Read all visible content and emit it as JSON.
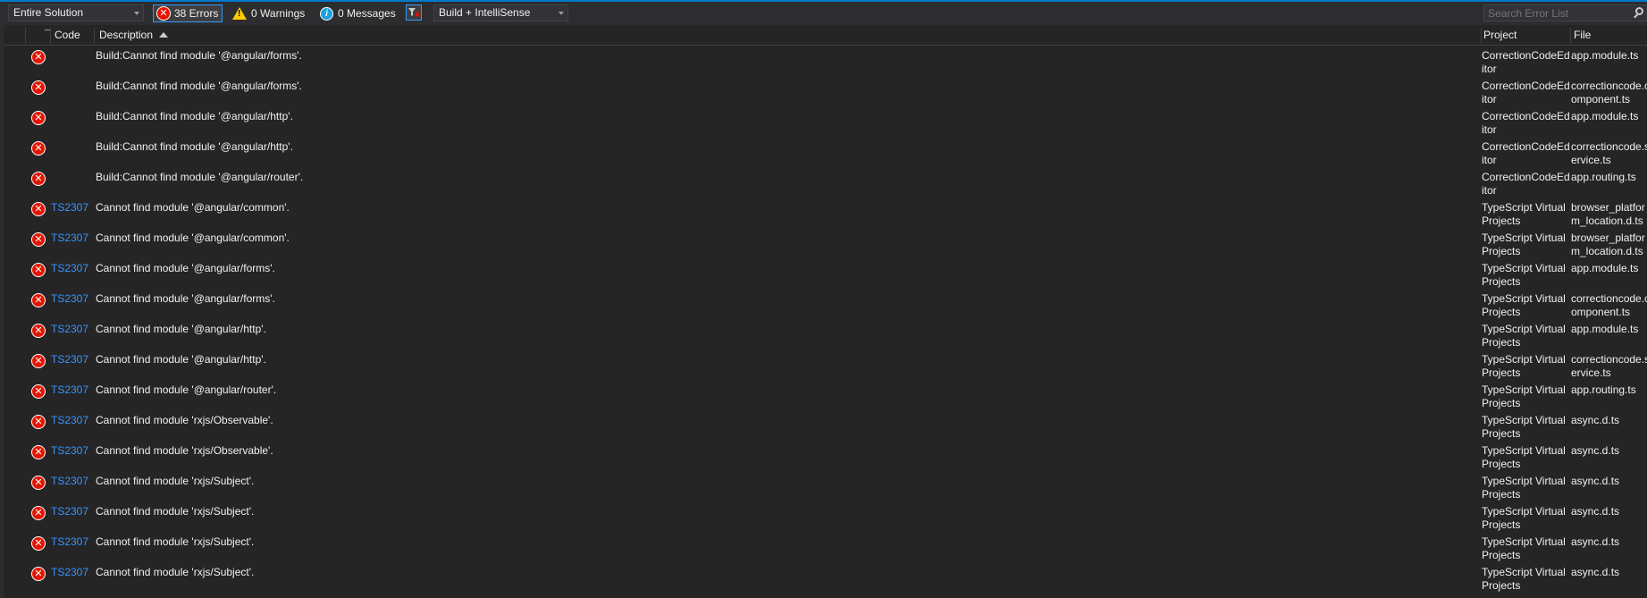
{
  "toolbar": {
    "scope_value": "Entire Solution",
    "errors_label": "38 Errors",
    "warnings_label": "0 Warnings",
    "messages_label": "0 Messages",
    "source_value": "Build + IntelliSense",
    "search_placeholder": "Search Error List"
  },
  "columns": {
    "code": "Code",
    "description": "Description",
    "project": "Project",
    "file": "File"
  },
  "rows": [
    {
      "code": "",
      "description": "Build:Cannot find module '@angular/forms'.",
      "project": "CorrectionCodeEditor",
      "file": "app.module.ts"
    },
    {
      "code": "",
      "description": "Build:Cannot find module '@angular/forms'.",
      "project": "CorrectionCodeEditor",
      "file": "correctioncode.component.ts"
    },
    {
      "code": "",
      "description": "Build:Cannot find module '@angular/http'.",
      "project": "CorrectionCodeEditor",
      "file": "app.module.ts"
    },
    {
      "code": "",
      "description": "Build:Cannot find module '@angular/http'.",
      "project": "CorrectionCodeEditor",
      "file": "correctioncode.service.ts"
    },
    {
      "code": "",
      "description": "Build:Cannot find module '@angular/router'.",
      "project": "CorrectionCodeEditor",
      "file": "app.routing.ts"
    },
    {
      "code": "TS2307",
      "description": "Cannot find module '@angular/common'.",
      "project": "TypeScript Virtual Projects",
      "file": "browser_platform_location.d.ts"
    },
    {
      "code": "TS2307",
      "description": "Cannot find module '@angular/common'.",
      "project": "TypeScript Virtual Projects",
      "file": "browser_platform_location.d.ts"
    },
    {
      "code": "TS2307",
      "description": "Cannot find module '@angular/forms'.",
      "project": "TypeScript Virtual Projects",
      "file": "app.module.ts"
    },
    {
      "code": "TS2307",
      "description": "Cannot find module '@angular/forms'.",
      "project": "TypeScript Virtual Projects",
      "file": "correctioncode.component.ts"
    },
    {
      "code": "TS2307",
      "description": "Cannot find module '@angular/http'.",
      "project": "TypeScript Virtual Projects",
      "file": "app.module.ts"
    },
    {
      "code": "TS2307",
      "description": "Cannot find module '@angular/http'.",
      "project": "TypeScript Virtual Projects",
      "file": "correctioncode.service.ts"
    },
    {
      "code": "TS2307",
      "description": "Cannot find module '@angular/router'.",
      "project": "TypeScript Virtual Projects",
      "file": "app.routing.ts"
    },
    {
      "code": "TS2307",
      "description": "Cannot find module 'rxjs/Observable'.",
      "project": "TypeScript Virtual Projects",
      "file": "async.d.ts"
    },
    {
      "code": "TS2307",
      "description": "Cannot find module 'rxjs/Observable'.",
      "project": "TypeScript Virtual Projects",
      "file": "async.d.ts"
    },
    {
      "code": "TS2307",
      "description": "Cannot find module 'rxjs/Subject'.",
      "project": "TypeScript Virtual Projects",
      "file": "async.d.ts"
    },
    {
      "code": "TS2307",
      "description": "Cannot find module 'rxjs/Subject'.",
      "project": "TypeScript Virtual Projects",
      "file": "async.d.ts"
    },
    {
      "code": "TS2307",
      "description": "Cannot find module 'rxjs/Subject'.",
      "project": "TypeScript Virtual Projects",
      "file": "async.d.ts"
    },
    {
      "code": "TS2307",
      "description": "Cannot find module 'rxjs/Subject'.",
      "project": "TypeScript Virtual Projects",
      "file": "async.d.ts"
    }
  ],
  "colors": {
    "background": "#252526",
    "toolbar": "#2d2d30",
    "accent": "#007acc",
    "code_link": "#3794ff",
    "error": "#e51400",
    "warning": "#ffcc00",
    "info": "#1ba1e2"
  }
}
